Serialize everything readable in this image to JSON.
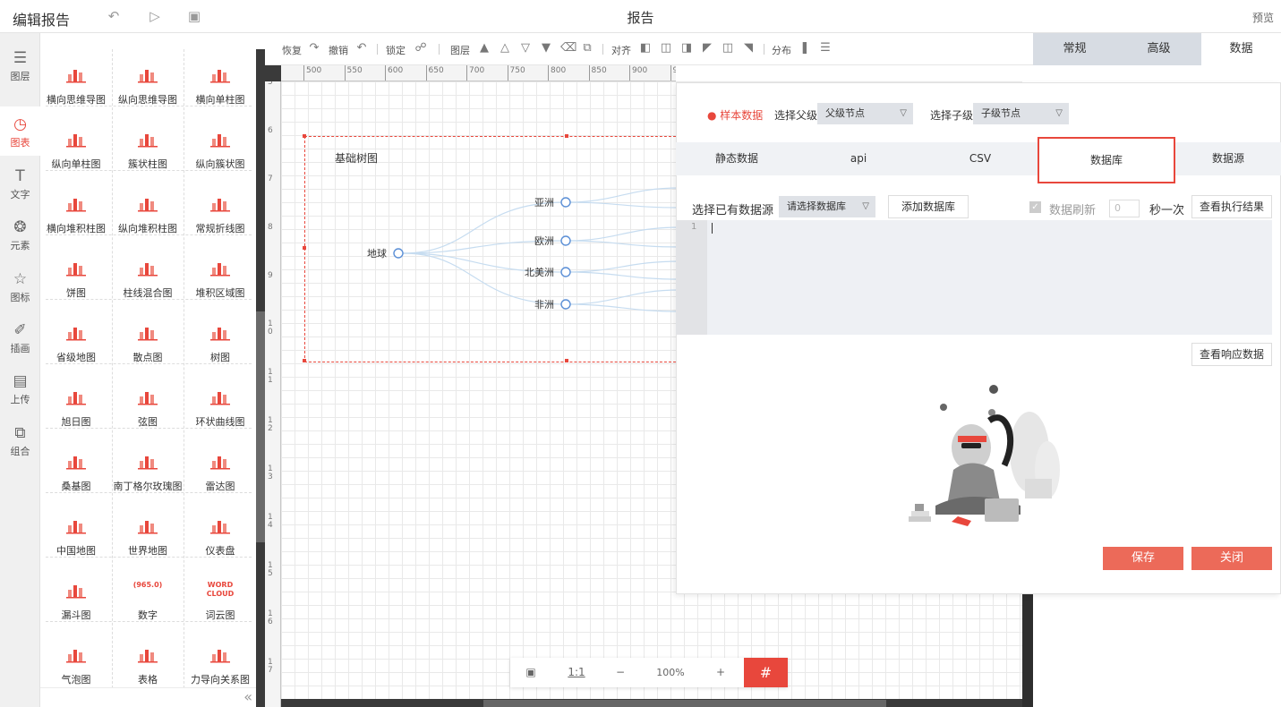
{
  "app": {
    "title": "编辑报告",
    "doc_title": "报告",
    "preview": "预览",
    "icons": {
      "undo": "undo-icon",
      "play": "play-icon",
      "save": "save-icon"
    }
  },
  "iconbar": [
    {
      "key": "layers",
      "label": "图层",
      "icon": "layers-icon"
    },
    {
      "key": "chart",
      "label": "图表",
      "icon": "chart-icon",
      "active": true
    },
    {
      "key": "text",
      "label": "文字",
      "icon": "text-icon"
    },
    {
      "key": "element",
      "label": "元素",
      "icon": "element-icon"
    },
    {
      "key": "mark",
      "label": "图标",
      "icon": "star-icon"
    },
    {
      "key": "illus",
      "label": "插画",
      "icon": "brush-icon"
    },
    {
      "key": "upload",
      "label": "上传",
      "icon": "image-upload-icon"
    },
    {
      "key": "group",
      "label": "组合",
      "icon": "group-icon"
    }
  ],
  "palette": [
    {
      "name": "横向思维导图",
      "icon": "mindmap-h-icon"
    },
    {
      "name": "纵向思维导图",
      "icon": "mindmap-v-icon"
    },
    {
      "name": "横向单柱图",
      "icon": "bar-h-single-icon"
    },
    {
      "name": "纵向单柱图",
      "icon": "bar-v-single-icon"
    },
    {
      "name": "簇状柱图",
      "icon": "bar-cluster-icon"
    },
    {
      "name": "纵向簇状图",
      "icon": "bar-cluster-v-icon"
    },
    {
      "name": "横向堆积柱图",
      "icon": "bar-stack-h-icon"
    },
    {
      "name": "纵向堆积柱图",
      "icon": "bar-stack-v-icon"
    },
    {
      "name": "常规折线图",
      "icon": "line-chart-icon"
    },
    {
      "name": "饼图",
      "icon": "pie-chart-icon"
    },
    {
      "name": "柱线混合图",
      "icon": "bar-line-mix-icon"
    },
    {
      "name": "堆积区域图",
      "icon": "area-chart-icon"
    },
    {
      "name": "省级地图",
      "icon": "province-map-icon"
    },
    {
      "name": "散点图",
      "icon": "scatter-icon"
    },
    {
      "name": "树图",
      "icon": "tree-icon"
    },
    {
      "name": "旭日图",
      "icon": "sunburst-icon"
    },
    {
      "name": "弦图",
      "icon": "chord-icon"
    },
    {
      "name": "环状曲线图",
      "icon": "ring-curve-icon"
    },
    {
      "name": "桑基图",
      "icon": "sankey-icon"
    },
    {
      "name": "南丁格尔玫瑰图",
      "icon": "rose-icon"
    },
    {
      "name": "雷达图",
      "icon": "radar-icon"
    },
    {
      "name": "中国地图",
      "icon": "china-map-icon"
    },
    {
      "name": "世界地图",
      "icon": "world-map-icon"
    },
    {
      "name": "仪表盘",
      "icon": "gauge-icon"
    },
    {
      "name": "漏斗图",
      "icon": "funnel-icon"
    },
    {
      "name": "数字",
      "icon": "number-icon",
      "glyph": "(965.0)"
    },
    {
      "name": "词云图",
      "icon": "wordcloud-icon",
      "glyph": "WORD CLOUD"
    },
    {
      "name": "气泡图",
      "icon": "bubble-icon"
    },
    {
      "name": "表格",
      "icon": "table-icon"
    },
    {
      "name": "力导向关系图",
      "icon": "force-graph-icon"
    }
  ],
  "canvas_toolbar": {
    "redo": "恢复",
    "undo": "撤销",
    "lock": "锁定",
    "layer": "图层",
    "align": "对齐",
    "distribute": "分布"
  },
  "ruler_h": [
    "500",
    "550",
    "600",
    "650",
    "700",
    "750",
    "800",
    "850",
    "900",
    "95"
  ],
  "ruler_v": [
    "5",
    "6",
    "7",
    "8",
    "9",
    "1 0",
    "1 1",
    "1 2",
    "1 3",
    "1 4",
    "1 5",
    "1 6",
    "1 7"
  ],
  "widget": {
    "title": "基础树图",
    "root": "地球",
    "children": [
      "亚洲",
      "欧洲",
      "北美洲",
      "非洲"
    ]
  },
  "zoom": {
    "ratio": "1:1",
    "minus": "−",
    "value": "100%",
    "plus": "+",
    "grid": "#"
  },
  "right_tabs": [
    {
      "label": "常规"
    },
    {
      "label": "高级"
    },
    {
      "label": "数据",
      "active": true
    }
  ],
  "data_panel": {
    "sample_data": "样本数据",
    "parent_label": "选择父级",
    "parent_value": "父级节点",
    "child_label": "选择子级",
    "child_value": "子级节点",
    "tabs": [
      "静态数据",
      "api",
      "CSV",
      "数据库",
      "数据源"
    ],
    "active_tab": "数据库",
    "select_source_label": "选择已有数据源",
    "select_source_value": "请选择数据库",
    "add_db": "添加数据库",
    "refresh_label": "数据刷新",
    "refresh_value": "0",
    "per_second": "秒一次",
    "view_exec": "查看执行结果",
    "line_no": "1",
    "view_response": "查看响应数据",
    "save": "保存",
    "close": "关闭"
  },
  "colors": {
    "accent": "#e8473c",
    "button": "#ec6a59",
    "tab_bg": "#d7dce3"
  }
}
